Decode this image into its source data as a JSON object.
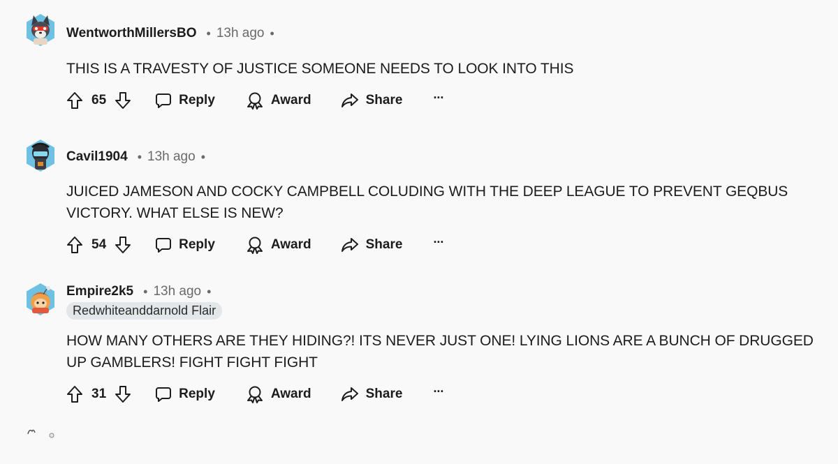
{
  "comments": [
    {
      "username": "WentworthMillersBO",
      "time": "13h ago",
      "flair": "",
      "body": "THIS IS A TRAVESTY OF JUSTICE SOMEONE NEEDS TO LOOK INTO THIS",
      "votes": "65",
      "avatar_icon": "wolf-avatar-icon"
    },
    {
      "username": "Cavil1904",
      "time": "13h ago",
      "flair": "",
      "body": "JUICED JAMESON AND COCKY CAMPBELL COLUDING WITH THE DEEP LEAGUE TO PREVENT GEQBUS VICTORY. WHAT ELSE IS NEW?",
      "votes": "54",
      "avatar_icon": "helmet-avatar-icon"
    },
    {
      "username": "Empire2k5",
      "time": "13h ago",
      "flair": "Redwhiteanddarnold Flair",
      "body": "HOW MANY OTHERS ARE THEY HIDING?! ITS NEVER JUST ONE! LYING LIONS ARE A BUNCH OF DRUGGED UP GAMBLERS! FIGHT FIGHT FIGHT",
      "votes": "31",
      "avatar_icon": "snoo-avatar-icon"
    }
  ],
  "labels": {
    "reply": "Reply",
    "award": "Award",
    "share": "Share",
    "more": "···"
  },
  "colors": {
    "background": "#f9f9f9",
    "text": "#1c1c1c",
    "meta": "#6a6a6a",
    "flair_bg": "#e4e7e9",
    "avatar_hex": "#6fc1e4"
  }
}
